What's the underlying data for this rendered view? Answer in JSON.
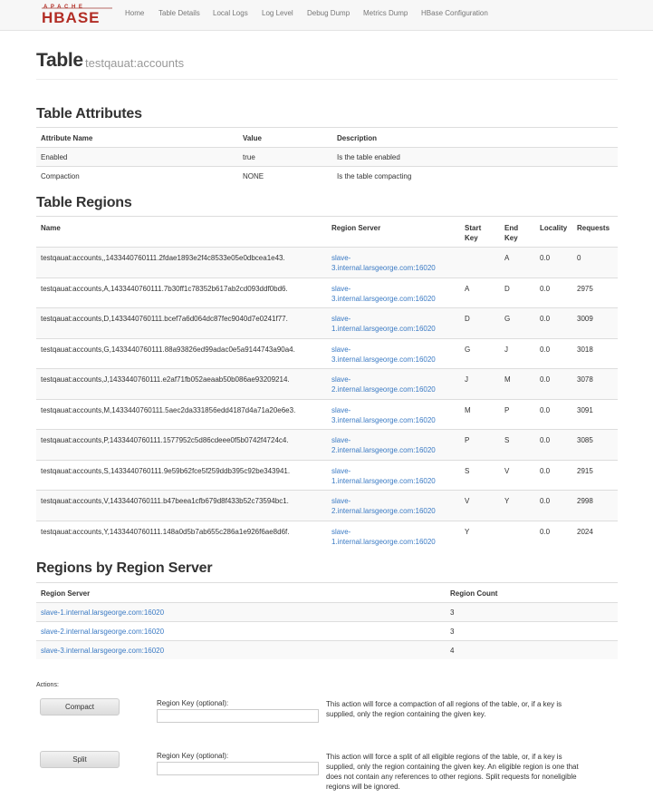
{
  "nav": {
    "logo_top": "APACHE",
    "logo_main": "HBASE",
    "items": [
      "Home",
      "Table Details",
      "Local Logs",
      "Log Level",
      "Debug Dump",
      "Metrics Dump",
      "HBase Configuration"
    ]
  },
  "page": {
    "title": "Table",
    "table_name": "testqauat:accounts"
  },
  "attributes": {
    "heading": "Table Attributes",
    "columns": [
      "Attribute Name",
      "Value",
      "Description"
    ],
    "rows": [
      [
        "Enabled",
        "true",
        "Is the table enabled"
      ],
      [
        "Compaction",
        "NONE",
        "Is the table compacting"
      ]
    ]
  },
  "regions": {
    "heading": "Table Regions",
    "columns": {
      "name": "Name",
      "server": "Region Server",
      "start_line1": "Start",
      "start_line2": "Key",
      "end_line1": "End",
      "end_line2": "Key",
      "locality": "Locality",
      "requests": "Requests"
    },
    "rows": [
      {
        "name": "testqauat:accounts,,1433440760111.2fdae1893e2f4c8533e05e0dbcea1e43.",
        "server_line1": "slave-",
        "server_line2": "3.internal.larsgeorge.com:16020",
        "start": "",
        "end": "A",
        "locality": "0.0",
        "requests": "0"
      },
      {
        "name": "testqauat:accounts,A,1433440760111.7b30ff1c78352b617ab2cd093ddf0bd6.",
        "server_line1": "slave-",
        "server_line2": "3.internal.larsgeorge.com:16020",
        "start": "A",
        "end": "D",
        "locality": "0.0",
        "requests": "2975"
      },
      {
        "name": "testqauat:accounts,D,1433440760111.bcef7a6d064dc87fec9040d7e0241f77.",
        "server_line1": "slave-",
        "server_line2": "1.internal.larsgeorge.com:16020",
        "start": "D",
        "end": "G",
        "locality": "0.0",
        "requests": "3009"
      },
      {
        "name": "testqauat:accounts,G,1433440760111.88a93826ed99adac0e5a9144743a90a4.",
        "server_line1": "slave-",
        "server_line2": "3.internal.larsgeorge.com:16020",
        "start": "G",
        "end": "J",
        "locality": "0.0",
        "requests": "3018"
      },
      {
        "name": "testqauat:accounts,J,1433440760111.e2af71fb052aeaab50b086ae93209214.",
        "server_line1": "slave-",
        "server_line2": "2.internal.larsgeorge.com:16020",
        "start": "J",
        "end": "M",
        "locality": "0.0",
        "requests": "3078"
      },
      {
        "name": "testqauat:accounts,M,1433440760111.5aec2da331856edd4187d4a71a20e6e3.",
        "server_line1": "slave-",
        "server_line2": "3.internal.larsgeorge.com:16020",
        "start": "M",
        "end": "P",
        "locality": "0.0",
        "requests": "3091"
      },
      {
        "name": "testqauat:accounts,P,1433440760111.1577952c5d86cdeee0f5b0742f4724c4.",
        "server_line1": "slave-",
        "server_line2": "2.internal.larsgeorge.com:16020",
        "start": "P",
        "end": "S",
        "locality": "0.0",
        "requests": "3085"
      },
      {
        "name": "testqauat:accounts,S,1433440760111.9e59b62fce5f259ddb395c92be343941.",
        "server_line1": "slave-",
        "server_line2": "1.internal.larsgeorge.com:16020",
        "start": "S",
        "end": "V",
        "locality": "0.0",
        "requests": "2915"
      },
      {
        "name": "testqauat:accounts,V,1433440760111.b47beea1cfb679d8f433b52c73594bc1.",
        "server_line1": "slave-",
        "server_line2": "2.internal.larsgeorge.com:16020",
        "start": "V",
        "end": "Y",
        "locality": "0.0",
        "requests": "2998"
      },
      {
        "name": "testqauat:accounts,Y,1433440760111.148a0d5b7ab655c286a1e926f6ae8d6f.",
        "server_line1": "slave-",
        "server_line2": "1.internal.larsgeorge.com:16020",
        "start": "Y",
        "end": "",
        "locality": "0.0",
        "requests": "2024"
      }
    ]
  },
  "by_server": {
    "heading": "Regions by Region Server",
    "columns": [
      "Region Server",
      "Region Count"
    ],
    "rows": [
      [
        "slave-1.internal.larsgeorge.com:16020",
        "3"
      ],
      [
        "slave-2.internal.larsgeorge.com:16020",
        "3"
      ],
      [
        "slave-3.internal.larsgeorge.com:16020",
        "4"
      ]
    ]
  },
  "actions": {
    "label": "Actions:",
    "compact": {
      "button": "Compact",
      "field_label": "Region Key (optional):",
      "value": "",
      "desc_lines": [
        "This action will force a compaction of all regions of the table, or, if a key is",
        "supplied, only the region containing the given key."
      ]
    },
    "split": {
      "button": "Split",
      "field_label": "Region Key (optional):",
      "value": "",
      "desc_lines": [
        "This action will force a split of all eligible regions of the table, or, if a key is",
        "supplied, only the region containing the given key. An eligible region is one that",
        "does not contain any references to other regions. Split requests for noneligible",
        "regions will be ignored."
      ]
    }
  },
  "colors": {
    "brand": "#b22d25",
    "link": "#3a7ac4",
    "navbar_bg": "#f7f7f7",
    "stripe": "#f9f9f9"
  }
}
